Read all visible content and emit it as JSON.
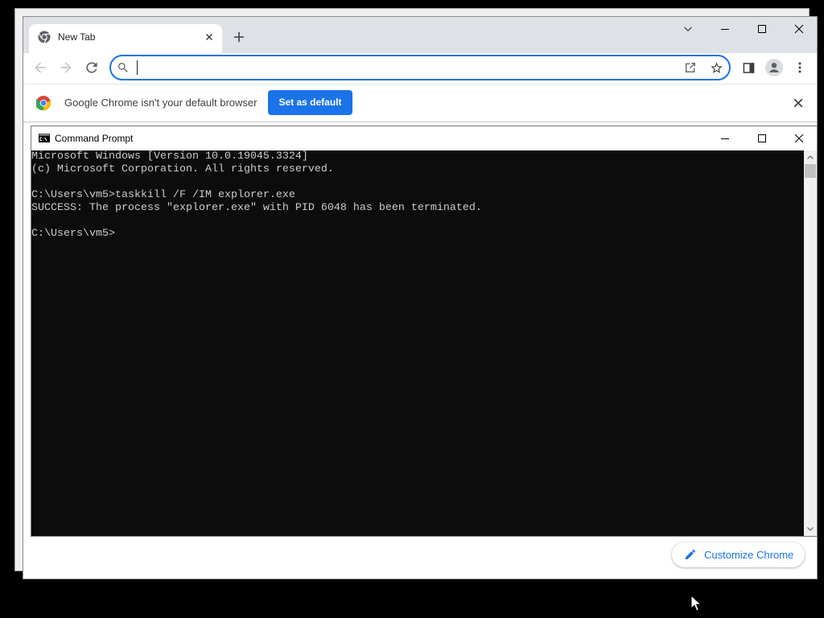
{
  "chrome": {
    "tab": {
      "title": "New Tab"
    },
    "toolbar": {
      "back_enabled": false,
      "forward_enabled": false
    },
    "infobar": {
      "message": "Google Chrome isn't your default browser",
      "button_label": "Set as default"
    },
    "customize_label": "Customize Chrome"
  },
  "cmd": {
    "title": "Command Prompt",
    "lines": [
      "Microsoft Windows [Version 10.0.19045.3324]",
      "(c) Microsoft Corporation. All rights reserved.",
      "",
      "C:\\Users\\vm5>taskkill /F /IM explorer.exe",
      "SUCCESS: The process \"explorer.exe\" with PID 6048 has been terminated.",
      "",
      "C:\\Users\\vm5>"
    ]
  },
  "colors": {
    "desktop": "#000000",
    "accent": "#1a73e8",
    "tabstrip": "#dee1e6",
    "console_bg": "#0c0c0c",
    "console_fg": "#cccccc"
  },
  "icons": {
    "tab_favicon": "chrome-icon",
    "tab_close": "close-icon",
    "new_tab": "plus-icon",
    "tab_search": "chevron-down-icon",
    "back": "arrow-left-icon",
    "forward": "arrow-right-icon",
    "reload": "reload-icon",
    "omnibox_search": "search-icon",
    "share": "share-icon",
    "bookmark": "star-icon",
    "side_panel": "side-panel-icon",
    "profile": "profile-icon",
    "menu": "more-vert-icon",
    "infobar_logo": "chrome-logo-icon",
    "infobar_close": "close-icon",
    "customize": "pencil-icon",
    "cmd_app": "cmd-icon",
    "mouse": "mouse-cursor-icon"
  }
}
